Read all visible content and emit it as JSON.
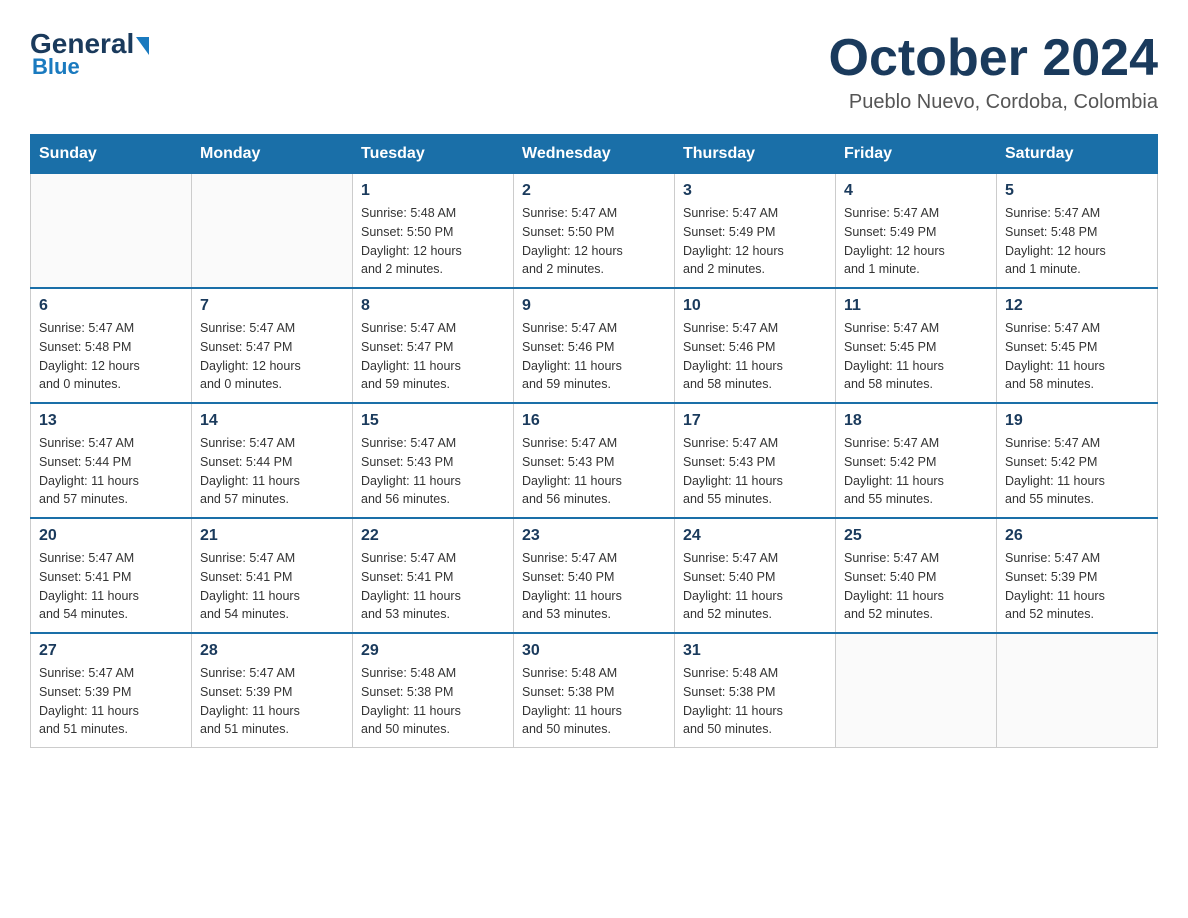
{
  "header": {
    "logo": {
      "general": "General",
      "blue": "Blue",
      "triangle": "▶"
    },
    "title": "October 2024",
    "subtitle": "Pueblo Nuevo, Cordoba, Colombia"
  },
  "calendar": {
    "days_of_week": [
      "Sunday",
      "Monday",
      "Tuesday",
      "Wednesday",
      "Thursday",
      "Friday",
      "Saturday"
    ],
    "weeks": [
      [
        {
          "day": "",
          "info": ""
        },
        {
          "day": "",
          "info": ""
        },
        {
          "day": "1",
          "info": "Sunrise: 5:48 AM\nSunset: 5:50 PM\nDaylight: 12 hours\nand 2 minutes."
        },
        {
          "day": "2",
          "info": "Sunrise: 5:47 AM\nSunset: 5:50 PM\nDaylight: 12 hours\nand 2 minutes."
        },
        {
          "day": "3",
          "info": "Sunrise: 5:47 AM\nSunset: 5:49 PM\nDaylight: 12 hours\nand 2 minutes."
        },
        {
          "day": "4",
          "info": "Sunrise: 5:47 AM\nSunset: 5:49 PM\nDaylight: 12 hours\nand 1 minute."
        },
        {
          "day": "5",
          "info": "Sunrise: 5:47 AM\nSunset: 5:48 PM\nDaylight: 12 hours\nand 1 minute."
        }
      ],
      [
        {
          "day": "6",
          "info": "Sunrise: 5:47 AM\nSunset: 5:48 PM\nDaylight: 12 hours\nand 0 minutes."
        },
        {
          "day": "7",
          "info": "Sunrise: 5:47 AM\nSunset: 5:47 PM\nDaylight: 12 hours\nand 0 minutes."
        },
        {
          "day": "8",
          "info": "Sunrise: 5:47 AM\nSunset: 5:47 PM\nDaylight: 11 hours\nand 59 minutes."
        },
        {
          "day": "9",
          "info": "Sunrise: 5:47 AM\nSunset: 5:46 PM\nDaylight: 11 hours\nand 59 minutes."
        },
        {
          "day": "10",
          "info": "Sunrise: 5:47 AM\nSunset: 5:46 PM\nDaylight: 11 hours\nand 58 minutes."
        },
        {
          "day": "11",
          "info": "Sunrise: 5:47 AM\nSunset: 5:45 PM\nDaylight: 11 hours\nand 58 minutes."
        },
        {
          "day": "12",
          "info": "Sunrise: 5:47 AM\nSunset: 5:45 PM\nDaylight: 11 hours\nand 58 minutes."
        }
      ],
      [
        {
          "day": "13",
          "info": "Sunrise: 5:47 AM\nSunset: 5:44 PM\nDaylight: 11 hours\nand 57 minutes."
        },
        {
          "day": "14",
          "info": "Sunrise: 5:47 AM\nSunset: 5:44 PM\nDaylight: 11 hours\nand 57 minutes."
        },
        {
          "day": "15",
          "info": "Sunrise: 5:47 AM\nSunset: 5:43 PM\nDaylight: 11 hours\nand 56 minutes."
        },
        {
          "day": "16",
          "info": "Sunrise: 5:47 AM\nSunset: 5:43 PM\nDaylight: 11 hours\nand 56 minutes."
        },
        {
          "day": "17",
          "info": "Sunrise: 5:47 AM\nSunset: 5:43 PM\nDaylight: 11 hours\nand 55 minutes."
        },
        {
          "day": "18",
          "info": "Sunrise: 5:47 AM\nSunset: 5:42 PM\nDaylight: 11 hours\nand 55 minutes."
        },
        {
          "day": "19",
          "info": "Sunrise: 5:47 AM\nSunset: 5:42 PM\nDaylight: 11 hours\nand 55 minutes."
        }
      ],
      [
        {
          "day": "20",
          "info": "Sunrise: 5:47 AM\nSunset: 5:41 PM\nDaylight: 11 hours\nand 54 minutes."
        },
        {
          "day": "21",
          "info": "Sunrise: 5:47 AM\nSunset: 5:41 PM\nDaylight: 11 hours\nand 54 minutes."
        },
        {
          "day": "22",
          "info": "Sunrise: 5:47 AM\nSunset: 5:41 PM\nDaylight: 11 hours\nand 53 minutes."
        },
        {
          "day": "23",
          "info": "Sunrise: 5:47 AM\nSunset: 5:40 PM\nDaylight: 11 hours\nand 53 minutes."
        },
        {
          "day": "24",
          "info": "Sunrise: 5:47 AM\nSunset: 5:40 PM\nDaylight: 11 hours\nand 52 minutes."
        },
        {
          "day": "25",
          "info": "Sunrise: 5:47 AM\nSunset: 5:40 PM\nDaylight: 11 hours\nand 52 minutes."
        },
        {
          "day": "26",
          "info": "Sunrise: 5:47 AM\nSunset: 5:39 PM\nDaylight: 11 hours\nand 52 minutes."
        }
      ],
      [
        {
          "day": "27",
          "info": "Sunrise: 5:47 AM\nSunset: 5:39 PM\nDaylight: 11 hours\nand 51 minutes."
        },
        {
          "day": "28",
          "info": "Sunrise: 5:47 AM\nSunset: 5:39 PM\nDaylight: 11 hours\nand 51 minutes."
        },
        {
          "day": "29",
          "info": "Sunrise: 5:48 AM\nSunset: 5:38 PM\nDaylight: 11 hours\nand 50 minutes."
        },
        {
          "day": "30",
          "info": "Sunrise: 5:48 AM\nSunset: 5:38 PM\nDaylight: 11 hours\nand 50 minutes."
        },
        {
          "day": "31",
          "info": "Sunrise: 5:48 AM\nSunset: 5:38 PM\nDaylight: 11 hours\nand 50 minutes."
        },
        {
          "day": "",
          "info": ""
        },
        {
          "day": "",
          "info": ""
        }
      ]
    ]
  }
}
